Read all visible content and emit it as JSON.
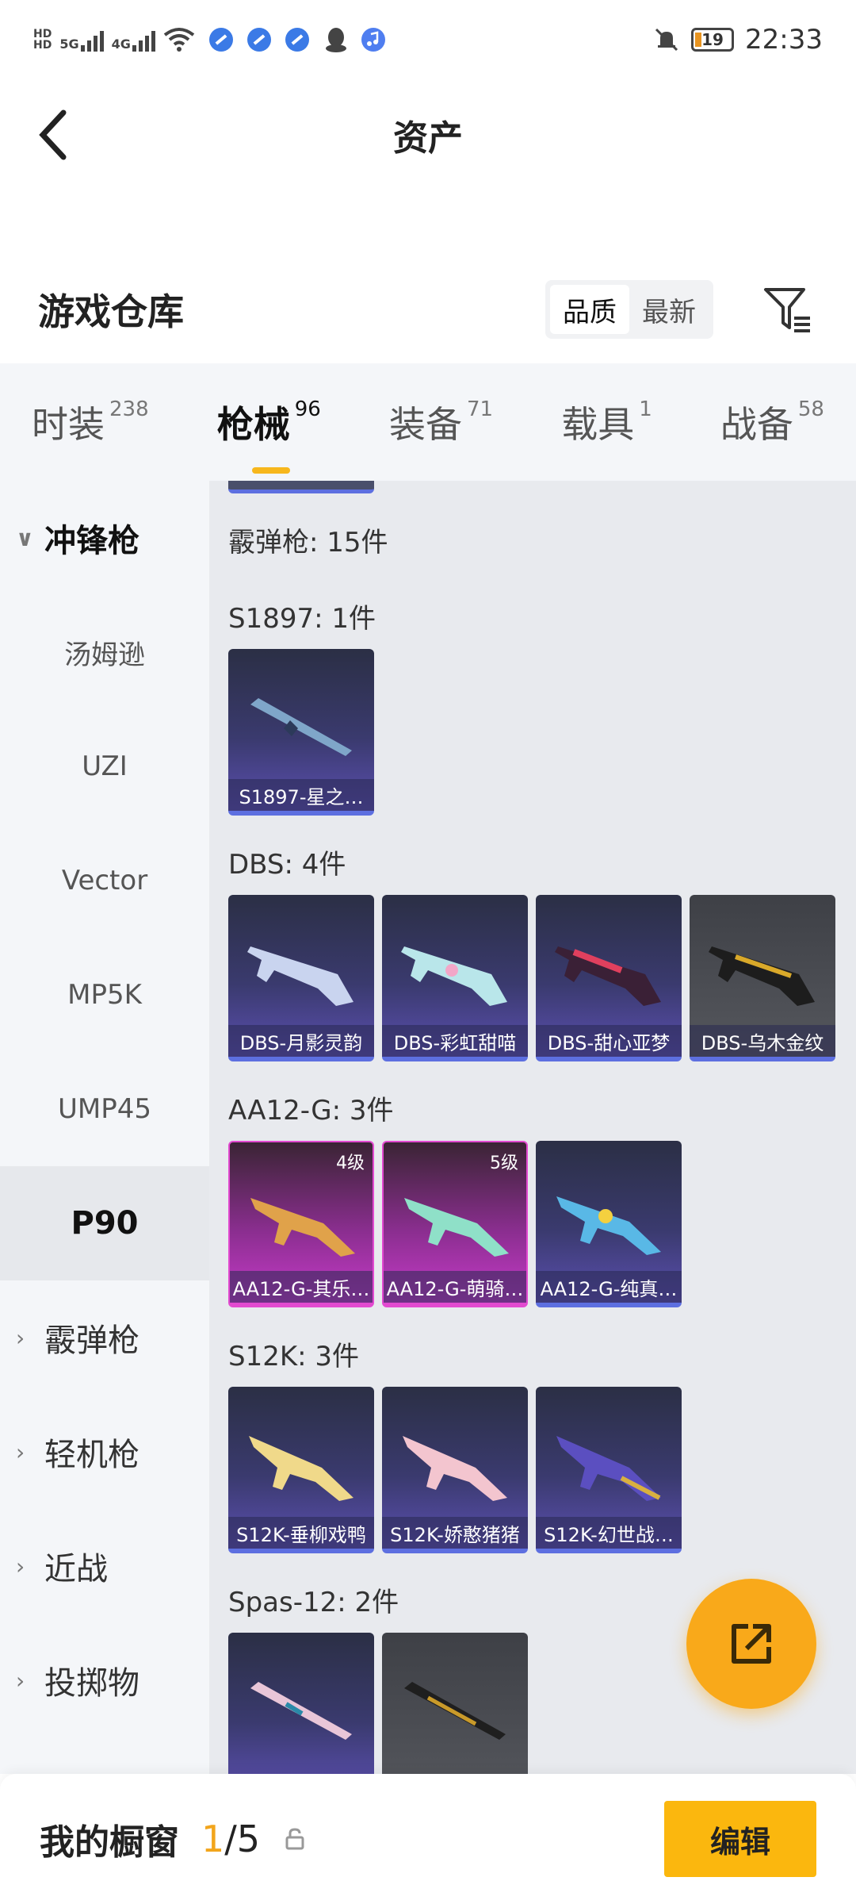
{
  "status_bar": {
    "time": "22:33",
    "battery": "19",
    "net_5g": "5G",
    "net_4g": "4G",
    "hd1": "HD",
    "hd2": "HD"
  },
  "header": {
    "title": "资产"
  },
  "warehouse": {
    "title": "游戏仓库",
    "sort_options": [
      "品质",
      "最新"
    ],
    "active_sort": "品质"
  },
  "tabs": [
    {
      "label": "时装",
      "count": "238"
    },
    {
      "label": "枪械",
      "count": "96"
    },
    {
      "label": "装备",
      "count": "71"
    },
    {
      "label": "载具",
      "count": "1"
    },
    {
      "label": "战备",
      "count": "58"
    }
  ],
  "sidebar": {
    "open_category": "冲锋枪",
    "sub_items": [
      "汤姆逊",
      "UZI",
      "Vector",
      "MP5K",
      "UMP45",
      "P90"
    ],
    "active_sub": "P90",
    "categories": [
      "霰弹枪",
      "轻机枪",
      "近战",
      "投掷物"
    ]
  },
  "content": {
    "group_title": "霰弹枪: 15件",
    "sections": [
      {
        "title": "S1897: 1件",
        "items": [
          {
            "name": "S1897-星之…",
            "rarity": "purple"
          }
        ]
      },
      {
        "title": "DBS: 4件",
        "items": [
          {
            "name": "DBS-月影灵韵",
            "rarity": "purple"
          },
          {
            "name": "DBS-彩虹甜喵",
            "rarity": "purple"
          },
          {
            "name": "DBS-甜心亚梦",
            "rarity": "purple"
          },
          {
            "name": "DBS-乌木金纹",
            "rarity": "gray"
          }
        ]
      },
      {
        "title": "AA12-G: 3件",
        "items": [
          {
            "name": "AA12-G-其乐…",
            "rarity": "pink",
            "level": "4级"
          },
          {
            "name": "AA12-G-萌骑…",
            "rarity": "pink",
            "level": "5级"
          },
          {
            "name": "AA12-G-纯真…",
            "rarity": "purple"
          }
        ]
      },
      {
        "title": "S12K: 3件",
        "items": [
          {
            "name": "S12K-垂柳戏鸭",
            "rarity": "purple"
          },
          {
            "name": "S12K-娇憨猪猪",
            "rarity": "purple"
          },
          {
            "name": "S12K-幻世战…",
            "rarity": "purple"
          }
        ]
      },
      {
        "title": "Spas-12: 2件",
        "items": [
          {
            "name": "",
            "rarity": "purple"
          },
          {
            "name": "",
            "rarity": "gray"
          }
        ]
      }
    ]
  },
  "bottom_bar": {
    "label": "我的橱窗",
    "current": "1",
    "separator": "/",
    "total": "5",
    "edit_label": "编辑"
  },
  "colors": {
    "accent": "#f7b71d",
    "purple_rarity": "#5d6fe0",
    "pink_rarity": "#e24ad0",
    "sidebar_bg": "#f4f6f9",
    "content_bg": "#e8eaee"
  }
}
